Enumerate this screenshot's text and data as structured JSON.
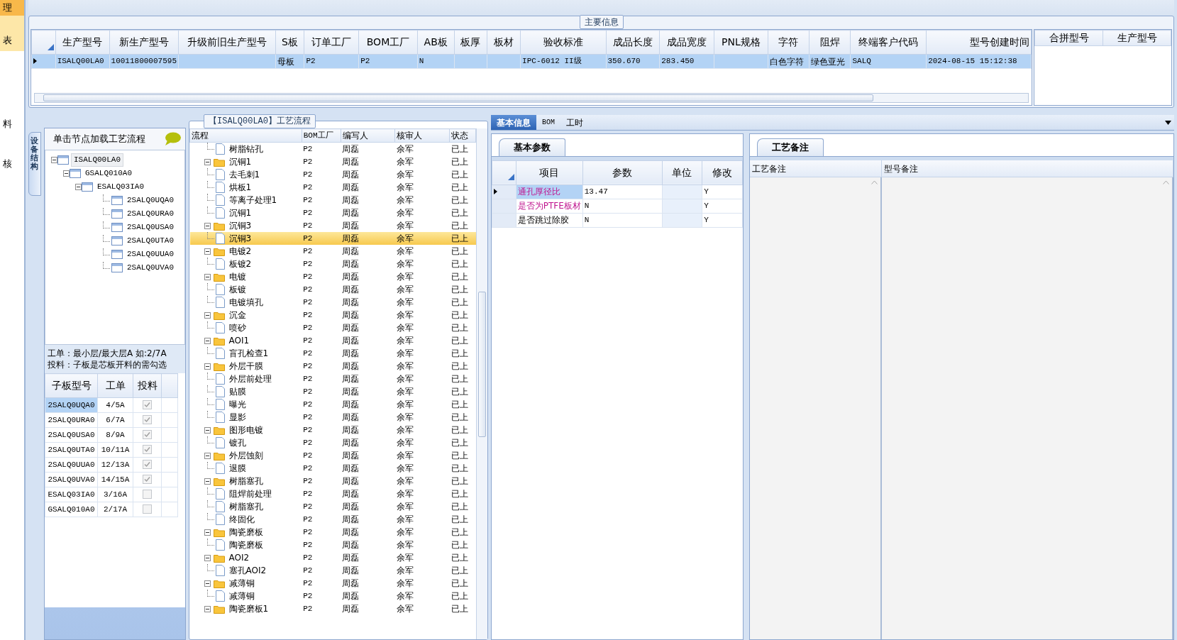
{
  "side_strip": [
    {
      "label": "理",
      "selected": true,
      "hovered": false
    },
    {
      "label": "表",
      "selected": false,
      "hovered": true
    },
    {
      "label": "料",
      "selected": false,
      "hovered": false
    },
    {
      "label": "核",
      "selected": false,
      "hovered": false
    }
  ],
  "main_info": {
    "title": "主要信息",
    "columns": [
      "生产型号",
      "新生产型号",
      "升级前旧生产型号",
      "S板",
      "订单工厂",
      "BOM工厂",
      "AB板",
      "板厚",
      "板材",
      "验收标准",
      "成品长度",
      "成品宽度",
      "PNL规格",
      "字符",
      "阻焊",
      "终端客户代码",
      "型号创建时间"
    ],
    "rows": [
      {
        "selected": true,
        "cells": [
          "ISALQ00LA0",
          "10011800007595",
          "",
          "母板",
          "P2",
          "P2",
          "N",
          "",
          "",
          "IPC-6012 II级",
          "350.670",
          "283.450",
          "",
          "白色字符",
          "绿色亚光",
          "SALQ",
          "2024-08-15 15:12:38"
        ]
      }
    ],
    "merge_columns": [
      "合拼型号",
      "生产型号"
    ]
  },
  "structure_panel": {
    "side_tab": "设备结构",
    "hint": "单击节点加载工艺流程",
    "tree": [
      {
        "label": "ISALQ00LA0",
        "selected": true,
        "expanded": true,
        "children": [
          {
            "label": "GSALQ010A0",
            "selected": false,
            "expanded": true,
            "children": [
              {
                "label": "ESALQ03IA0",
                "selected": false,
                "expanded": true,
                "children": [
                  {
                    "label": "2SALQ0UQA0",
                    "selected": false
                  },
                  {
                    "label": "2SALQ0URA0",
                    "selected": false
                  },
                  {
                    "label": "2SALQ0USA0",
                    "selected": false
                  },
                  {
                    "label": "2SALQ0UTA0",
                    "selected": false
                  },
                  {
                    "label": "2SALQ0UUA0",
                    "selected": false
                  },
                  {
                    "label": "2SALQ0UVA0",
                    "selected": false
                  }
                ]
              }
            ]
          }
        ]
      }
    ],
    "notes": [
      "工单：最小层/最大层A 如:2/7A",
      "投料：子板是芯板开料的需勾选"
    ],
    "columns": [
      "子板型号",
      "工单",
      "投料"
    ],
    "rows": [
      {
        "model": "2SALQ0UQA0",
        "order": "4/5A",
        "checked": true,
        "selected": true
      },
      {
        "model": "2SALQ0URA0",
        "order": "6/7A",
        "checked": true,
        "selected": false
      },
      {
        "model": "2SALQ0USA0",
        "order": "8/9A",
        "checked": true,
        "selected": false
      },
      {
        "model": "2SALQ0UTA0",
        "order": "10/11A",
        "checked": true,
        "selected": false
      },
      {
        "model": "2SALQ0UUA0",
        "order": "12/13A",
        "checked": true,
        "selected": false
      },
      {
        "model": "2SALQ0UVA0",
        "order": "14/15A",
        "checked": true,
        "selected": false
      },
      {
        "model": "ESALQ03IA0",
        "order": "3/16A",
        "checked": false,
        "selected": false
      },
      {
        "model": "GSALQ010A0",
        "order": "2/17A",
        "checked": false,
        "selected": false
      }
    ]
  },
  "process_panel": {
    "title": "【ISALQ00LA0】工艺流程",
    "columns": [
      "流程",
      "BOM工厂",
      "编写人",
      "核审人",
      "状态"
    ],
    "nodes": [
      {
        "kind": "file",
        "name": "树脂钻孔",
        "factory": "P2",
        "writer": "周磊",
        "reviewer": "余军",
        "status": "已上",
        "selected": false
      },
      {
        "kind": "folder",
        "name": "沉铜1",
        "factory": "P2",
        "writer": "周磊",
        "reviewer": "余军",
        "status": "已上",
        "selected": false,
        "expanded": true,
        "children": [
          {
            "kind": "file",
            "name": "去毛刺1",
            "factory": "P2",
            "writer": "周磊",
            "reviewer": "余军",
            "status": "已上",
            "selected": false
          },
          {
            "kind": "file",
            "name": "烘板1",
            "factory": "P2",
            "writer": "周磊",
            "reviewer": "余军",
            "status": "已上",
            "selected": false
          },
          {
            "kind": "file",
            "name": "等离子处理1",
            "factory": "P2",
            "writer": "周磊",
            "reviewer": "余军",
            "status": "已上",
            "selected": false
          },
          {
            "kind": "file",
            "name": "沉铜1",
            "factory": "P2",
            "writer": "周磊",
            "reviewer": "余军",
            "status": "已上",
            "selected": false
          }
        ]
      },
      {
        "kind": "folder",
        "name": "沉铜3",
        "factory": "P2",
        "writer": "周磊",
        "reviewer": "余军",
        "status": "已上",
        "selected": false,
        "expanded": true,
        "children": [
          {
            "kind": "file",
            "name": "沉铜3",
            "factory": "P2",
            "writer": "周磊",
            "reviewer": "余军",
            "status": "已上",
            "selected": true
          }
        ]
      },
      {
        "kind": "folder",
        "name": "电镀2",
        "factory": "P2",
        "writer": "周磊",
        "reviewer": "余军",
        "status": "已上",
        "selected": false,
        "expanded": true,
        "children": [
          {
            "kind": "file",
            "name": "板镀2",
            "factory": "P2",
            "writer": "周磊",
            "reviewer": "余军",
            "status": "已上",
            "selected": false
          }
        ]
      },
      {
        "kind": "folder",
        "name": "电镀",
        "factory": "P2",
        "writer": "周磊",
        "reviewer": "余军",
        "status": "已上",
        "selected": false,
        "expanded": true,
        "children": [
          {
            "kind": "file",
            "name": "板镀",
            "factory": "P2",
            "writer": "周磊",
            "reviewer": "余军",
            "status": "已上",
            "selected": false
          },
          {
            "kind": "file",
            "name": "电镀填孔",
            "factory": "P2",
            "writer": "周磊",
            "reviewer": "余军",
            "status": "已上",
            "selected": false
          }
        ]
      },
      {
        "kind": "folder",
        "name": "沉金",
        "factory": "P2",
        "writer": "周磊",
        "reviewer": "余军",
        "status": "已上",
        "selected": false,
        "expanded": true,
        "children": [
          {
            "kind": "file",
            "name": "喷砂",
            "factory": "P2",
            "writer": "周磊",
            "reviewer": "余军",
            "status": "已上",
            "selected": false
          }
        ]
      },
      {
        "kind": "folder",
        "name": "AOI1",
        "factory": "P2",
        "writer": "周磊",
        "reviewer": "余军",
        "status": "已上",
        "selected": false,
        "expanded": true,
        "children": [
          {
            "kind": "file",
            "name": "盲孔检查1",
            "factory": "P2",
            "writer": "周磊",
            "reviewer": "余军",
            "status": "已上",
            "selected": false
          }
        ]
      },
      {
        "kind": "folder",
        "name": "外层干膜",
        "factory": "P2",
        "writer": "周磊",
        "reviewer": "余军",
        "status": "已上",
        "selected": false,
        "expanded": true,
        "children": [
          {
            "kind": "file",
            "name": "外层前处理",
            "factory": "P2",
            "writer": "周磊",
            "reviewer": "余军",
            "status": "已上",
            "selected": false
          },
          {
            "kind": "file",
            "name": "贴膜",
            "factory": "P2",
            "writer": "周磊",
            "reviewer": "余军",
            "status": "已上",
            "selected": false
          },
          {
            "kind": "file",
            "name": "曝光",
            "factory": "P2",
            "writer": "周磊",
            "reviewer": "余军",
            "status": "已上",
            "selected": false
          },
          {
            "kind": "file",
            "name": "显影",
            "factory": "P2",
            "writer": "周磊",
            "reviewer": "余军",
            "status": "已上",
            "selected": false
          }
        ]
      },
      {
        "kind": "folder",
        "name": "图形电镀",
        "factory": "P2",
        "writer": "周磊",
        "reviewer": "余军",
        "status": "已上",
        "selected": false,
        "expanded": true,
        "children": [
          {
            "kind": "file",
            "name": "镀孔",
            "factory": "P2",
            "writer": "周磊",
            "reviewer": "余军",
            "status": "已上",
            "selected": false
          }
        ]
      },
      {
        "kind": "folder",
        "name": "外层蚀刻",
        "factory": "P2",
        "writer": "周磊",
        "reviewer": "余军",
        "status": "已上",
        "selected": false,
        "expanded": true,
        "children": [
          {
            "kind": "file",
            "name": "退膜",
            "factory": "P2",
            "writer": "周磊",
            "reviewer": "余军",
            "status": "已上",
            "selected": false
          }
        ]
      },
      {
        "kind": "folder",
        "name": "树脂塞孔",
        "factory": "P2",
        "writer": "周磊",
        "reviewer": "余军",
        "status": "已上",
        "selected": false,
        "expanded": true,
        "children": [
          {
            "kind": "file",
            "name": "阻焊前处理",
            "factory": "P2",
            "writer": "周磊",
            "reviewer": "余军",
            "status": "已上",
            "selected": false
          },
          {
            "kind": "file",
            "name": "树脂塞孔",
            "factory": "P2",
            "writer": "周磊",
            "reviewer": "余军",
            "status": "已上",
            "selected": false
          },
          {
            "kind": "file",
            "name": "终固化",
            "factory": "P2",
            "writer": "周磊",
            "reviewer": "余军",
            "status": "已上",
            "selected": false
          }
        ]
      },
      {
        "kind": "folder",
        "name": "陶瓷磨板",
        "factory": "P2",
        "writer": "周磊",
        "reviewer": "余军",
        "status": "已上",
        "selected": false,
        "expanded": true,
        "children": [
          {
            "kind": "file",
            "name": "陶瓷磨板",
            "factory": "P2",
            "writer": "周磊",
            "reviewer": "余军",
            "status": "已上",
            "selected": false
          }
        ]
      },
      {
        "kind": "folder",
        "name": "AOI2",
        "factory": "P2",
        "writer": "周磊",
        "reviewer": "余军",
        "status": "已上",
        "selected": false,
        "expanded": true,
        "children": [
          {
            "kind": "file",
            "name": "塞孔AOI2",
            "factory": "P2",
            "writer": "周磊",
            "reviewer": "余军",
            "status": "已上",
            "selected": false
          }
        ]
      },
      {
        "kind": "folder",
        "name": "减薄铜",
        "factory": "P2",
        "writer": "周磊",
        "reviewer": "余军",
        "status": "已上",
        "selected": false,
        "expanded": true,
        "children": [
          {
            "kind": "file",
            "name": "减薄铜",
            "factory": "P2",
            "writer": "周磊",
            "reviewer": "余军",
            "status": "已上",
            "selected": false
          }
        ]
      },
      {
        "kind": "folder",
        "name": "陶瓷磨板1",
        "factory": "P2",
        "writer": "周磊",
        "reviewer": "余军",
        "status": "已上",
        "selected": false,
        "expanded": true
      }
    ]
  },
  "detail_tabs": [
    {
      "label": "基本信息",
      "selected": true
    },
    {
      "label": "BOM",
      "selected": false
    },
    {
      "label": "工时",
      "selected": false
    }
  ],
  "params_panel": {
    "tab": "基本参数",
    "columns": [
      "项目",
      "参数",
      "单位",
      "修改"
    ],
    "rows": [
      {
        "item": "通孔厚径比",
        "highlighted": true,
        "value": "13.47",
        "modified": "Y",
        "selected": true
      },
      {
        "item": "是否为PTFE板材",
        "highlighted": true,
        "value": "N",
        "modified": "Y",
        "selected": false
      },
      {
        "item": "是否跳过除胶",
        "highlighted": false,
        "value": "N",
        "modified": "Y",
        "selected": false
      }
    ]
  },
  "notes_panel": {
    "tab": "工艺备注",
    "columns": [
      "工艺备注",
      "型号备注"
    ]
  }
}
